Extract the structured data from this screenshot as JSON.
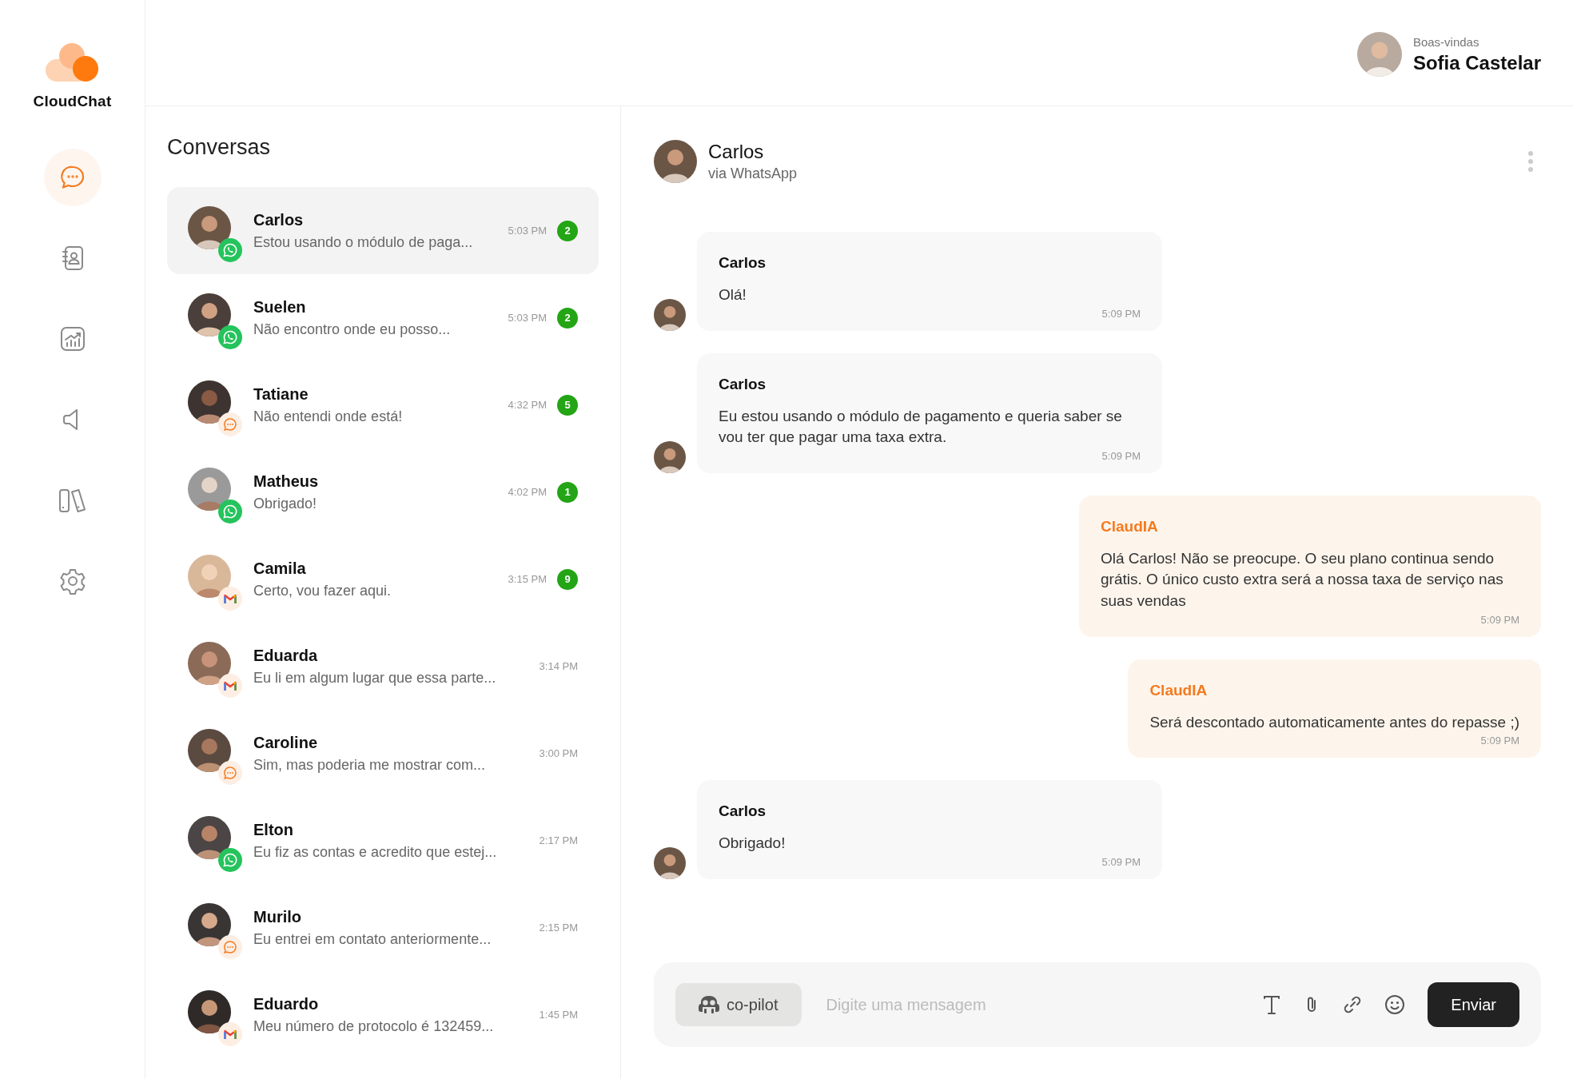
{
  "app": {
    "name": "CloudChat"
  },
  "nav": [
    {
      "kind": "chat",
      "selected": true
    },
    {
      "kind": "contacts",
      "selected": false
    },
    {
      "kind": "analytics",
      "selected": false
    },
    {
      "kind": "campaigns",
      "selected": false
    },
    {
      "kind": "library",
      "selected": false
    },
    {
      "kind": "settings",
      "selected": false
    }
  ],
  "user": {
    "greeting": "Boas-vindas",
    "name": "Sofia Castelar"
  },
  "conversations": {
    "title": "Conversas",
    "items": [
      {
        "name": "Carlos",
        "preview": "Estou usando o módulo de paga...",
        "time": "5:03 PM",
        "unread": "2",
        "kind": "whatsapp",
        "selected": true
      },
      {
        "name": "Suelen",
        "preview": "Não encontro onde eu posso...",
        "time": "5:03 PM",
        "unread": "2",
        "kind": "whatsapp",
        "selected": false
      },
      {
        "name": "Tatiane",
        "preview": "Não entendi onde está!",
        "time": "4:32 PM",
        "unread": "5",
        "kind": "chat",
        "selected": false
      },
      {
        "name": "Matheus",
        "preview": "Obrigado!",
        "time": "4:02 PM",
        "unread": "1",
        "kind": "whatsapp",
        "selected": false
      },
      {
        "name": "Camila",
        "preview": "Certo, vou fazer aqui.",
        "time": "3:15 PM",
        "unread": "9",
        "kind": "gmail",
        "selected": false
      },
      {
        "name": "Eduarda",
        "preview": "Eu li em algum lugar que essa parte...",
        "time": "3:14 PM",
        "kind": "gmail",
        "selected": false
      },
      {
        "name": "Caroline",
        "preview": "Sim, mas poderia me mostrar com...",
        "time": "3:00 PM",
        "kind": "chat",
        "selected": false
      },
      {
        "name": "Elton",
        "preview": "Eu fiz as contas e acredito que estej...",
        "time": "2:17 PM",
        "kind": "whatsapp",
        "selected": false
      },
      {
        "name": "Murilo",
        "preview": "Eu entrei em contato anteriormente...",
        "time": "2:15 PM",
        "kind": "chat",
        "selected": false
      },
      {
        "name": "Eduardo",
        "preview": "Meu número de protocolo é 132459...",
        "time": "1:45 PM",
        "kind": "gmail",
        "selected": false
      }
    ]
  },
  "chat": {
    "contact": {
      "name": "Carlos",
      "via": "via WhatsApp"
    },
    "messages": [
      {
        "kind": "in",
        "sender": "Carlos",
        "text": "Olá!",
        "time": "5:09 PM"
      },
      {
        "kind": "in",
        "sender": "Carlos",
        "text": "Eu estou usando o módulo de pagamento e queria saber se vou ter que pagar uma taxa extra.",
        "time": "5:09 PM"
      },
      {
        "kind": "out",
        "sender": "ClaudIA",
        "text": "Olá Carlos! Não se preocupe. O seu plano continua sendo grátis. O único custo extra será a nossa taxa de serviço nas suas vendas",
        "time": "5:09 PM"
      },
      {
        "kind": "out",
        "sender": "ClaudIA",
        "text": "Será descontado automaticamente antes do repasse ;)",
        "time": "5:09 PM"
      },
      {
        "kind": "in",
        "sender": "Carlos",
        "text": "Obrigado!",
        "time": "5:09 PM"
      }
    ],
    "composer": {
      "copilot": "co-pilot",
      "placeholder": "Digite uma mensagem",
      "send": "Enviar"
    }
  }
}
